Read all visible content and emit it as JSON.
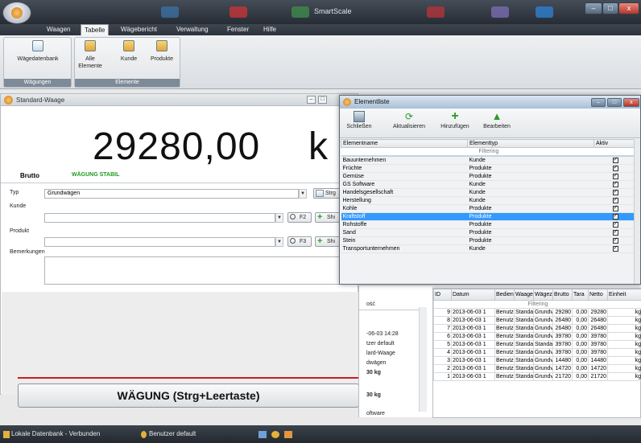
{
  "app": {
    "title": "SmartScale"
  },
  "menu": {
    "tabs": [
      "Waagen",
      "Tabelle",
      "Wägebericht",
      "Verwaltung",
      "Fenster",
      "Hilfe"
    ],
    "active": "Tabelle"
  },
  "ribbon": {
    "group1": {
      "label": "Wägungen",
      "button": "Wägedatenbank"
    },
    "group2": {
      "label": "Elemente",
      "buttons": [
        "Alle Elemente",
        "Kunde",
        "Produkte"
      ]
    }
  },
  "scale": {
    "title": "Standard-Waage",
    "weight": "29280,00",
    "unit": "k",
    "brutto": "Brutto",
    "status": "WÄGUNG STABIL",
    "typ_label": "Typ",
    "typ_value": "Grundwägen",
    "strg_btn": "Strg",
    "kunde_label": "Kunde",
    "f2": "F2",
    "produkt_label": "Produkt",
    "f3": "F3",
    "shi": "Shi",
    "bemerkungen_label": "Bemerkungen",
    "weigh_button": "WÄGUNG (Strg+Leertaste)"
  },
  "middle": {
    "lines": [
      "ość",
      "-06-03 14:28",
      "tzer default",
      "lard-Waage",
      "dwägen",
      "30 kg",
      "30 kg",
      "oftware"
    ]
  },
  "weighings": {
    "columns": [
      "ID",
      "Datum",
      "Bedien",
      "Waage",
      "Wägez",
      "Brutto",
      "Tara",
      "Netto",
      "Einheit"
    ],
    "filter": "Filtering",
    "rows": [
      [
        "9",
        "2013-06-03 1",
        "Benutz",
        "Standa",
        "Grundv",
        "29280",
        "0,00",
        "29280",
        "kg"
      ],
      [
        "8",
        "2013-06-03 1",
        "Benutz",
        "Standa",
        "Grundv",
        "26480",
        "0,00",
        "26480",
        "kg"
      ],
      [
        "7",
        "2013-06-03 1",
        "Benutz",
        "Standa",
        "Grundv",
        "26480",
        "0,00",
        "26480",
        "kg"
      ],
      [
        "6",
        "2013-06-03 1",
        "Benutz",
        "Standa",
        "Grundv",
        "39780",
        "0,00",
        "39780",
        "kg"
      ],
      [
        "5",
        "2013-06-03 1",
        "Benutz",
        "Standa",
        "Standa",
        "39780",
        "0,00",
        "39780",
        "kg"
      ],
      [
        "4",
        "2013-06-03 1",
        "Benutz",
        "Standa",
        "Grundv",
        "39780",
        "0,00",
        "39780",
        "kg"
      ],
      [
        "3",
        "2013-06-03 1",
        "Benutz",
        "Standa",
        "Grundv",
        "14480",
        "0,00",
        "14480",
        "kg"
      ],
      [
        "2",
        "2013-06-03 1",
        "Benutz",
        "Standa",
        "Grundv",
        "14720",
        "0,00",
        "14720",
        "kg"
      ],
      [
        "1",
        "2013-06-03 1",
        "Benutz",
        "Standa",
        "Grundv",
        "21720",
        "0,00",
        "21720",
        "kg"
      ]
    ]
  },
  "elementliste": {
    "title": "Elementliste",
    "toolbar": [
      "Schließen",
      "Aktualisieren",
      "Hinzufügen",
      "Bearbeiten"
    ],
    "columns": [
      "Elementname",
      "Elementtyp",
      "Aktiv"
    ],
    "filter": "Filtering",
    "rows": [
      [
        "Bauunternehmen",
        "Kunde"
      ],
      [
        "Früchte",
        "Produkte"
      ],
      [
        "Gemüse",
        "Produkte"
      ],
      [
        "GS Software",
        "Kunde"
      ],
      [
        "Handelsgesellschaft",
        "Kunde"
      ],
      [
        "Herstellung",
        "Kunde"
      ],
      [
        "Kohle",
        "Produkte"
      ],
      [
        "Kraftstoff",
        "Produkte"
      ],
      [
        "Rohstoffe",
        "Produkte"
      ],
      [
        "Sand",
        "Produkte"
      ],
      [
        "Stein",
        "Produkte"
      ],
      [
        "Transportunternehmen",
        "Kunde"
      ]
    ],
    "selected": "Kraftstoff"
  },
  "status": {
    "db": "Lokale Datenbank - Verbunden",
    "user": "Benutzer default"
  }
}
